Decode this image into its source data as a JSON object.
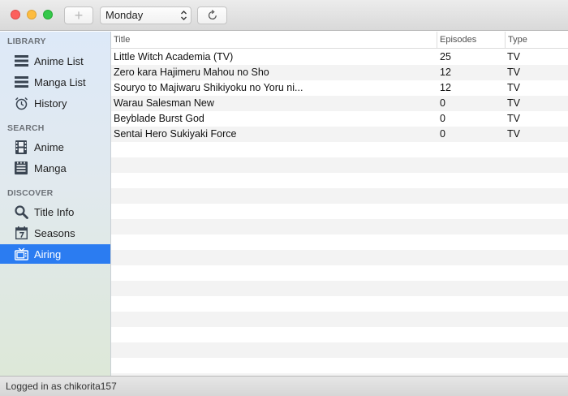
{
  "toolbar": {
    "add_label": "+",
    "day_select": {
      "value": "Monday"
    },
    "refresh_icon": "refresh-icon"
  },
  "sidebar": {
    "sections": [
      {
        "label": "LIBRARY",
        "items": [
          {
            "label": "Anime List",
            "icon": "list-icon"
          },
          {
            "label": "Manga List",
            "icon": "list-icon"
          },
          {
            "label": "History",
            "icon": "alarm-clock-icon"
          }
        ]
      },
      {
        "label": "SEARCH",
        "items": [
          {
            "label": "Anime",
            "icon": "film-icon"
          },
          {
            "label": "Manga",
            "icon": "book-icon"
          }
        ]
      },
      {
        "label": "DISCOVER",
        "items": [
          {
            "label": "Title Info",
            "icon": "magnifier-icon"
          },
          {
            "label": "Seasons",
            "icon": "calendar-icon"
          },
          {
            "label": "Airing",
            "icon": "tv-icon",
            "active": true
          }
        ]
      }
    ]
  },
  "table": {
    "columns": [
      "Title",
      "Episodes",
      "Type"
    ],
    "rows": [
      {
        "title": "Little Witch Academia (TV)",
        "episodes": "25",
        "type": "TV"
      },
      {
        "title": "Zero kara Hajimeru Mahou no Sho",
        "episodes": "12",
        "type": "TV"
      },
      {
        "title": "Souryo to Majiwaru Shikiyoku no Yoru ni...",
        "episodes": "12",
        "type": "TV"
      },
      {
        "title": "Warau Salesman New",
        "episodes": "0",
        "type": "TV"
      },
      {
        "title": "Beyblade Burst God",
        "episodes": "0",
        "type": "TV"
      },
      {
        "title": "Sentai Hero Sukiyaki Force",
        "episodes": "0",
        "type": "TV"
      }
    ]
  },
  "status": {
    "text": "Logged in as chikorita157"
  },
  "colors": {
    "accent": "#2b7cf1",
    "close": "#fc605c",
    "minimize": "#fdbc40",
    "maximize": "#34c84a"
  }
}
